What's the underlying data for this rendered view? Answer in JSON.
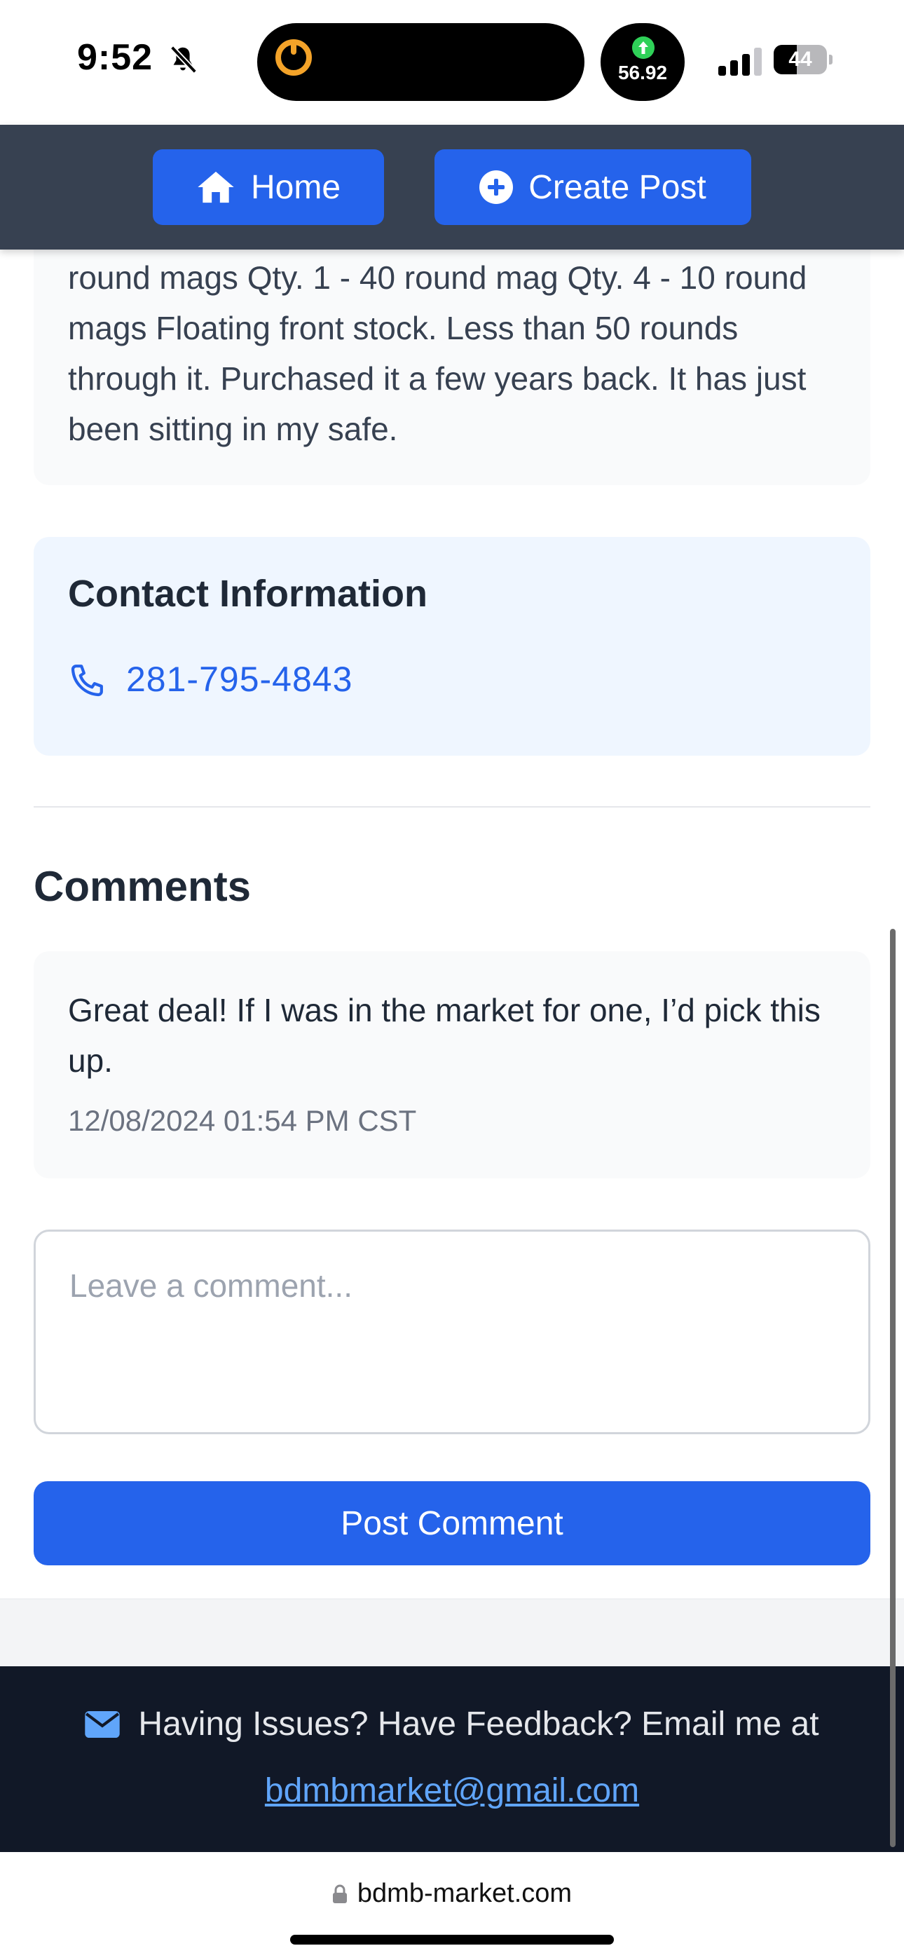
{
  "status_bar": {
    "time": "9:52",
    "speed_value": "56.92",
    "battery_level": "44",
    "icons": [
      "bell-slash-icon",
      "timer-icon",
      "upload-arrow-icon",
      "signal-icon",
      "battery-icon"
    ]
  },
  "nav": {
    "home_label": "Home",
    "create_label": "Create Post",
    "home_icon": "home-icon",
    "create_icon": "plus-circle-icon"
  },
  "post": {
    "description_tail": "round mags Qty. 1 - 40 round mag Qty. 4 - 10 round mags Floating front stock. Less than 50 rounds through it. Purchased it a few years back. It has just been sitting in my safe."
  },
  "contact": {
    "title": "Contact Information",
    "phone": "281-795-4843",
    "icon": "phone-icon"
  },
  "comments": {
    "title": "Comments",
    "items": [
      {
        "text": "Great deal! If I was in the market for one, I’d pick this up.",
        "timestamp": "12/08/2024 01:54 PM CST"
      }
    ],
    "input_placeholder": "Leave a comment...",
    "input_value": "",
    "submit_label": "Post Comment"
  },
  "footer": {
    "message": "Having Issues? Have Feedback? Email me at",
    "email": "bdmbmarket@gmail.com",
    "icon": "envelope-icon"
  },
  "browser": {
    "url": "bdmb-market.com",
    "icon": "lock-icon"
  },
  "colors": {
    "primary": "#2563eb",
    "nav_bg": "#374151",
    "footer_bg": "#111827",
    "contact_bg": "#eff6ff",
    "link_footer": "#60a5fa"
  }
}
